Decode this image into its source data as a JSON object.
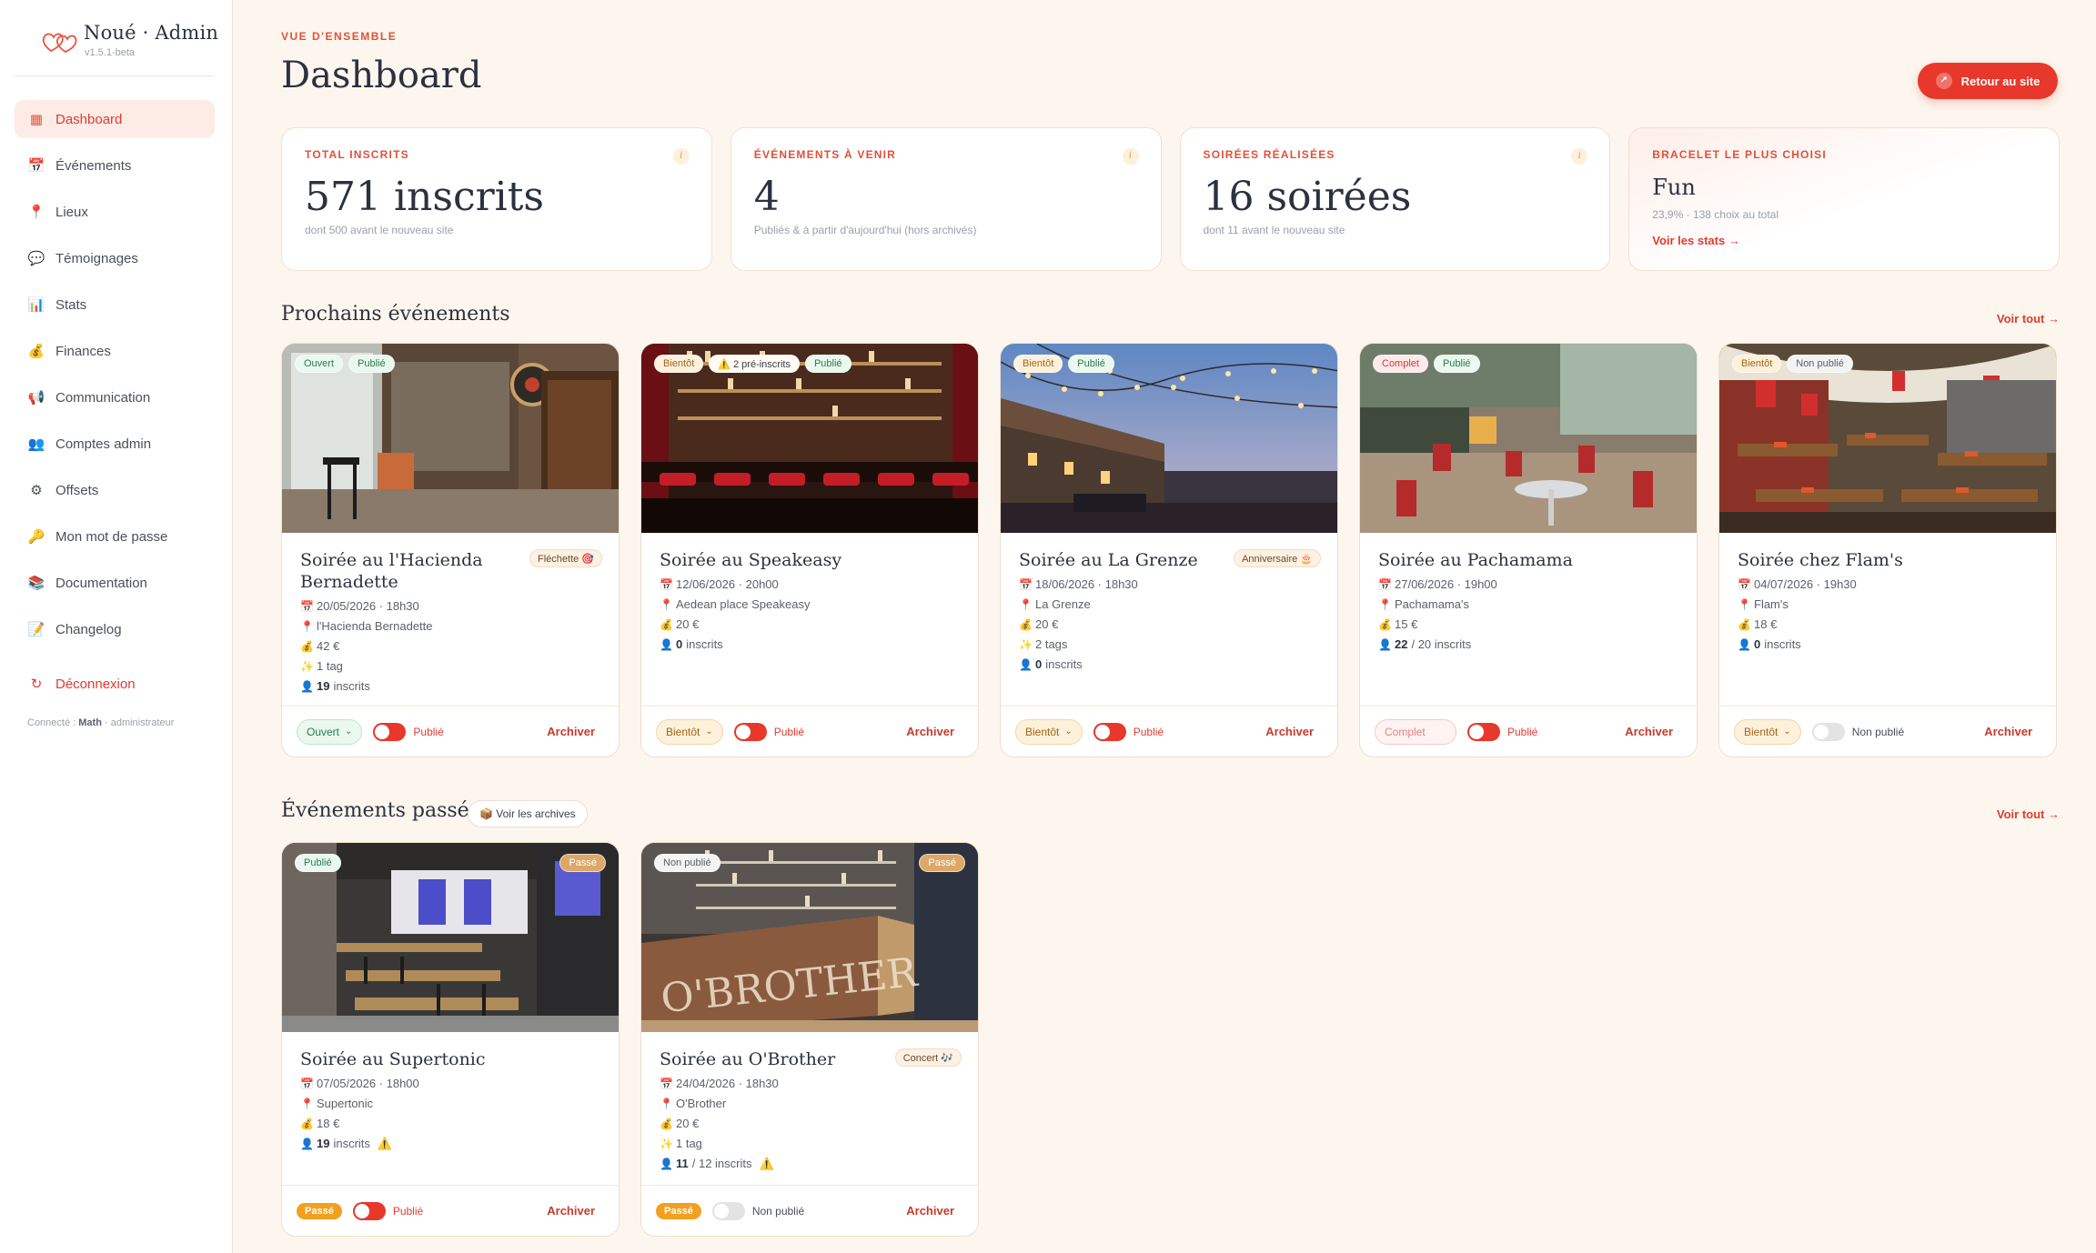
{
  "brand": {
    "title": "Noué · Admin",
    "version": "v1.5.1-beta"
  },
  "nav": [
    {
      "label": "Dashboard",
      "icon": "dashboard-icon",
      "glyph": "▦",
      "active": true
    },
    {
      "label": "Événements",
      "icon": "calendar-icon",
      "glyph": "📅"
    },
    {
      "label": "Lieux",
      "icon": "pin-icon",
      "glyph": "📍"
    },
    {
      "label": "Témoignages",
      "icon": "speech-icon",
      "glyph": "💬"
    },
    {
      "label": "Stats",
      "icon": "chart-icon",
      "glyph": "📊"
    },
    {
      "label": "Finances",
      "icon": "money-bag-icon",
      "glyph": "💰"
    },
    {
      "label": "Communication",
      "icon": "megaphone-icon",
      "glyph": "📢"
    },
    {
      "label": "Comptes admin",
      "icon": "users-icon",
      "glyph": "👥"
    },
    {
      "label": "Offsets",
      "icon": "gear-icon",
      "glyph": "⚙"
    },
    {
      "label": "Mon mot de passe",
      "icon": "key-icon",
      "glyph": "🔑"
    },
    {
      "label": "Documentation",
      "icon": "books-icon",
      "glyph": "📚"
    },
    {
      "label": "Changelog",
      "icon": "memo-icon",
      "glyph": "📝"
    }
  ],
  "logout": {
    "label": "Déconnexion",
    "glyph": "↻"
  },
  "connected": {
    "prefix": "Connecté : ",
    "user": "Math",
    "role": " · administrateur"
  },
  "header": {
    "eyebrow": "VUE D'ENSEMBLE",
    "title": "Dashboard",
    "site_button": "Retour au site"
  },
  "stats": {
    "inscrits": {
      "label": "TOTAL INSCRITS",
      "value": "571 inscrits",
      "sub": "dont 500 avant le nouveau site"
    },
    "avenir": {
      "label": "ÉVÉNEMENTS À VENIR",
      "value": "4",
      "sub": "Publiés & à partir d'aujourd'hui (hors archivés)"
    },
    "soirees": {
      "label": "SOIRÉES RÉALISÉES",
      "value": "16 soirées",
      "sub": "dont 11 avant le nouveau site"
    },
    "bracelet": {
      "label": "BRACELET LE PLUS CHOISI",
      "value": "Fun",
      "sub": "23,9% · 138 choix au total",
      "link": "Voir les stats →"
    },
    "info": "i"
  },
  "upcoming": {
    "title": "Prochains événements",
    "see_all": "Voir tout →"
  },
  "past": {
    "title": "Événements passés",
    "archives": "📦 Voir les archives",
    "see_all": "Voir tout →"
  },
  "labels": {
    "archive": "Archiver"
  },
  "upcoming_events": [
    {
      "title": "Soirée au l'Hacienda Bernadette",
      "tags": [
        "Ouvert",
        "Publié"
      ],
      "theme": "Fléchette 🎯",
      "date": "20/05/2026 · 18h30",
      "place": "l'Hacienda Bernadette",
      "price": "42 €",
      "extra": "1 tag",
      "count": "19",
      "inscrits": "inscrits",
      "status": "Ouvert",
      "published": "Publié"
    },
    {
      "title": "Soirée au Speakeasy",
      "tags": [
        "Bientôt",
        "⚠️ 2 pré-inscrits",
        "Publié"
      ],
      "date": "12/06/2026 · 20h00",
      "place": "Aedean place Speakeasy",
      "price": "20 €",
      "count": "0",
      "inscrits": "inscrits",
      "status": "Bientôt",
      "published": "Publié"
    },
    {
      "title": "Soirée au La Grenze",
      "tags": [
        "Bientôt",
        "Publié"
      ],
      "theme": "Anniversaire 🎂",
      "date": "18/06/2026 · 18h30",
      "place": "La Grenze",
      "price": "20 €",
      "extra": "2 tags",
      "count": "0",
      "inscrits": "inscrits",
      "status": "Bientôt",
      "published": "Publié"
    },
    {
      "title": "Soirée au Pachamama",
      "tags": [
        "Complet",
        "Publié"
      ],
      "date": "27/06/2026 · 19h00",
      "place": "Pachamama's",
      "price": "15 €",
      "count": "22",
      "inscrits": "/ 20 inscrits",
      "status": "Complet",
      "published": "Publié"
    },
    {
      "title": "Soirée chez Flam's",
      "tags": [
        "Bientôt",
        "Non publié"
      ],
      "date": "04/07/2026 · 19h30",
      "place": "Flam's",
      "price": "18 €",
      "count": "0",
      "inscrits": "inscrits",
      "status": "Bientôt",
      "published": "Non publié"
    }
  ],
  "past_events": [
    {
      "title": "Soirée au Supertonic",
      "tags": [
        "Publié"
      ],
      "past": "Passé",
      "date": "07/05/2026 · 18h00",
      "place": "Supertonic",
      "price": "18 €",
      "count": "19",
      "inscrits": "inscrits",
      "warn": "⚠️",
      "status": "Passé",
      "published": "Publié"
    },
    {
      "title": "Soirée au O'Brother",
      "tags": [
        "Non publié"
      ],
      "past": "Passé",
      "theme": "Concert 🎶",
      "date": "24/04/2026 · 18h30",
      "place": "O'Brother",
      "price": "20 €",
      "extra": "1 tag",
      "count": "11",
      "inscrits": "/ 12 inscrits",
      "warn": "⚠️",
      "status": "Passé",
      "published": "Non publié",
      "sign": "O'BROTHER"
    }
  ],
  "glyphs": {
    "date": "📅",
    "place": "📍",
    "price": "💰",
    "extra": "✨",
    "people": "👤",
    "chevron": "⌄"
  }
}
